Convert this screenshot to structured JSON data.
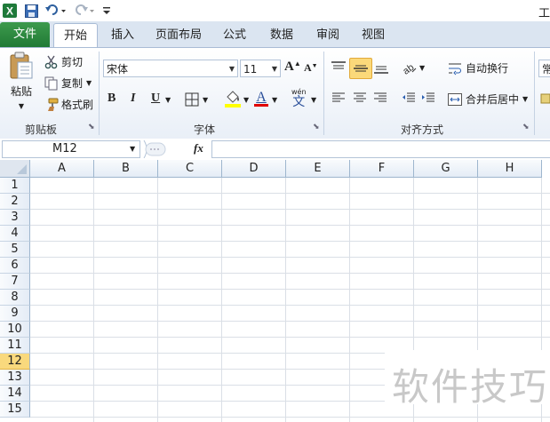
{
  "title_fragment": "工",
  "qat": {
    "excel_icon": "excel-app-icon",
    "save_icon": "save-icon",
    "undo_icon": "undo-icon",
    "redo_icon": "redo-icon",
    "customize_icon": "customize-qat-icon"
  },
  "tabs": [
    {
      "id": "file",
      "label": "文件"
    },
    {
      "id": "home",
      "label": "开始"
    },
    {
      "id": "insert",
      "label": "插入"
    },
    {
      "id": "layout",
      "label": "页面布局"
    },
    {
      "id": "formulas",
      "label": "公式"
    },
    {
      "id": "data",
      "label": "数据"
    },
    {
      "id": "review",
      "label": "审阅"
    },
    {
      "id": "view",
      "label": "视图"
    }
  ],
  "clipboard": {
    "paste_label": "粘贴",
    "cut_label": "剪切",
    "copy_label": "复制",
    "format_painter_label": "格式刷",
    "group_label": "剪贴板"
  },
  "font": {
    "font_name": "宋体",
    "font_size": "11",
    "bold": "B",
    "italic": "I",
    "underline": "U",
    "grow": "A",
    "shrink": "A",
    "font_color_letter": "A",
    "phonetic_top": "wén",
    "phonetic_char": "文",
    "group_label": "字体",
    "highlight_color": "#ffff00",
    "font_color": "#e00000"
  },
  "alignment": {
    "wrap_text_label": "自动换行",
    "merge_center_label": "合并后居中",
    "group_label": "对齐方式"
  },
  "number": {
    "format_fragment": "常"
  },
  "formula_bar": {
    "name_box": "M12",
    "fx_label": "fx",
    "formula": ""
  },
  "columns": [
    "A",
    "B",
    "C",
    "D",
    "E",
    "F",
    "G",
    "H"
  ],
  "rows": [
    "1",
    "2",
    "3",
    "4",
    "5",
    "6",
    "7",
    "8",
    "9",
    "10",
    "11",
    "12",
    "13",
    "14",
    "15"
  ],
  "selected_row": "12",
  "watermark_text": "软件技巧"
}
